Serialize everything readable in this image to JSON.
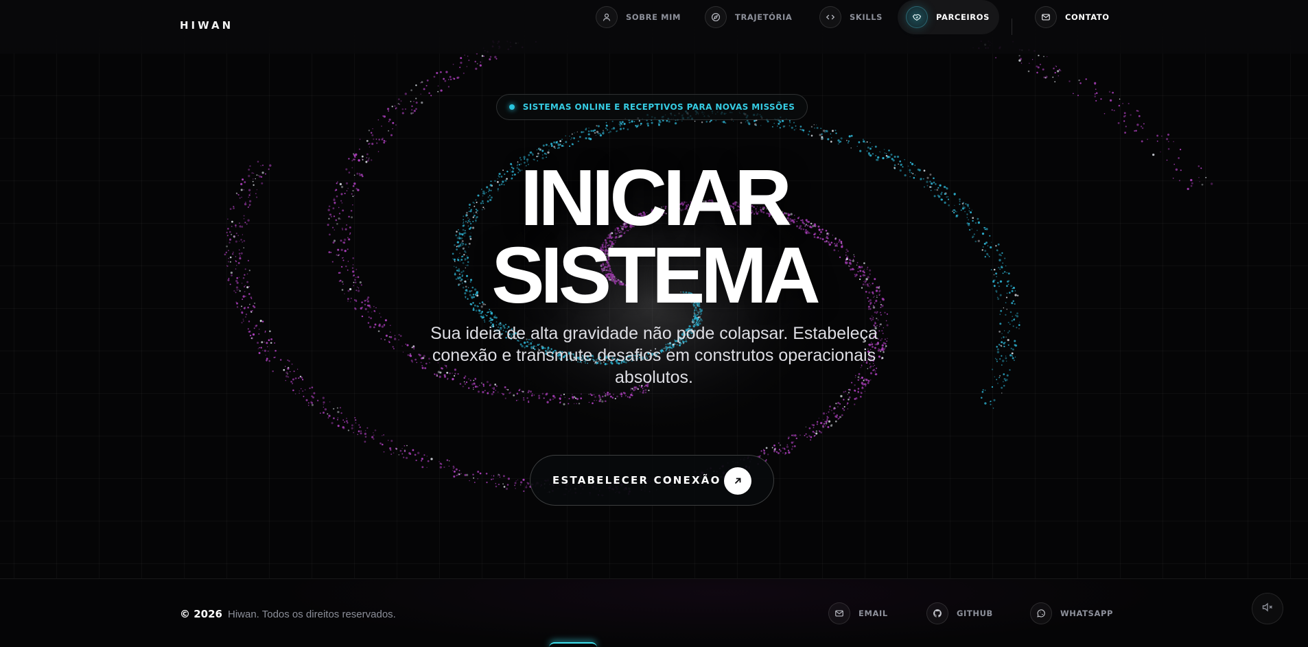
{
  "brand": {
    "logo": "HIWAN"
  },
  "nav": {
    "items": [
      {
        "label": "SOBRE MIM",
        "icon": "user-icon"
      },
      {
        "label": "TRAJETÓRIA",
        "icon": "compass-icon"
      },
      {
        "label": "SKILLS",
        "icon": "code-icon"
      },
      {
        "label": "PARCEIROS",
        "icon": "handshake-icon",
        "active": true
      },
      {
        "label": "CONTATO",
        "icon": "mail-icon"
      }
    ]
  },
  "hero": {
    "status": "SISTEMAS ONLINE E RECEPTIVOS PARA NOVAS MISSÕES",
    "title_line1": "INICIAR",
    "title_line2": "SISTEMA",
    "subtitle": "Sua ideia de alta gravidade não pode colapsar. Estabeleça conexão e transmute desafios em construtos operacionais absolutos.",
    "cta_label": "ESTABELECER CONEXÃO",
    "cta_icon": "arrow-up-right-icon"
  },
  "footer": {
    "year": "© 2026",
    "copyright": "Hiwan. Todos os direitos reservados.",
    "links": [
      {
        "label": "EMAIL",
        "icon": "mail-icon"
      },
      {
        "label": "GITHUB",
        "icon": "github-icon"
      },
      {
        "label": "WHATSAPP",
        "icon": "whatsapp-icon"
      }
    ],
    "mute_icon": "speaker-muted-icon"
  },
  "colors": {
    "background": "#050506",
    "accent_cyan": "#29c4dd",
    "accent_magenta": "#b040c0",
    "text_muted": "#8d909a"
  }
}
